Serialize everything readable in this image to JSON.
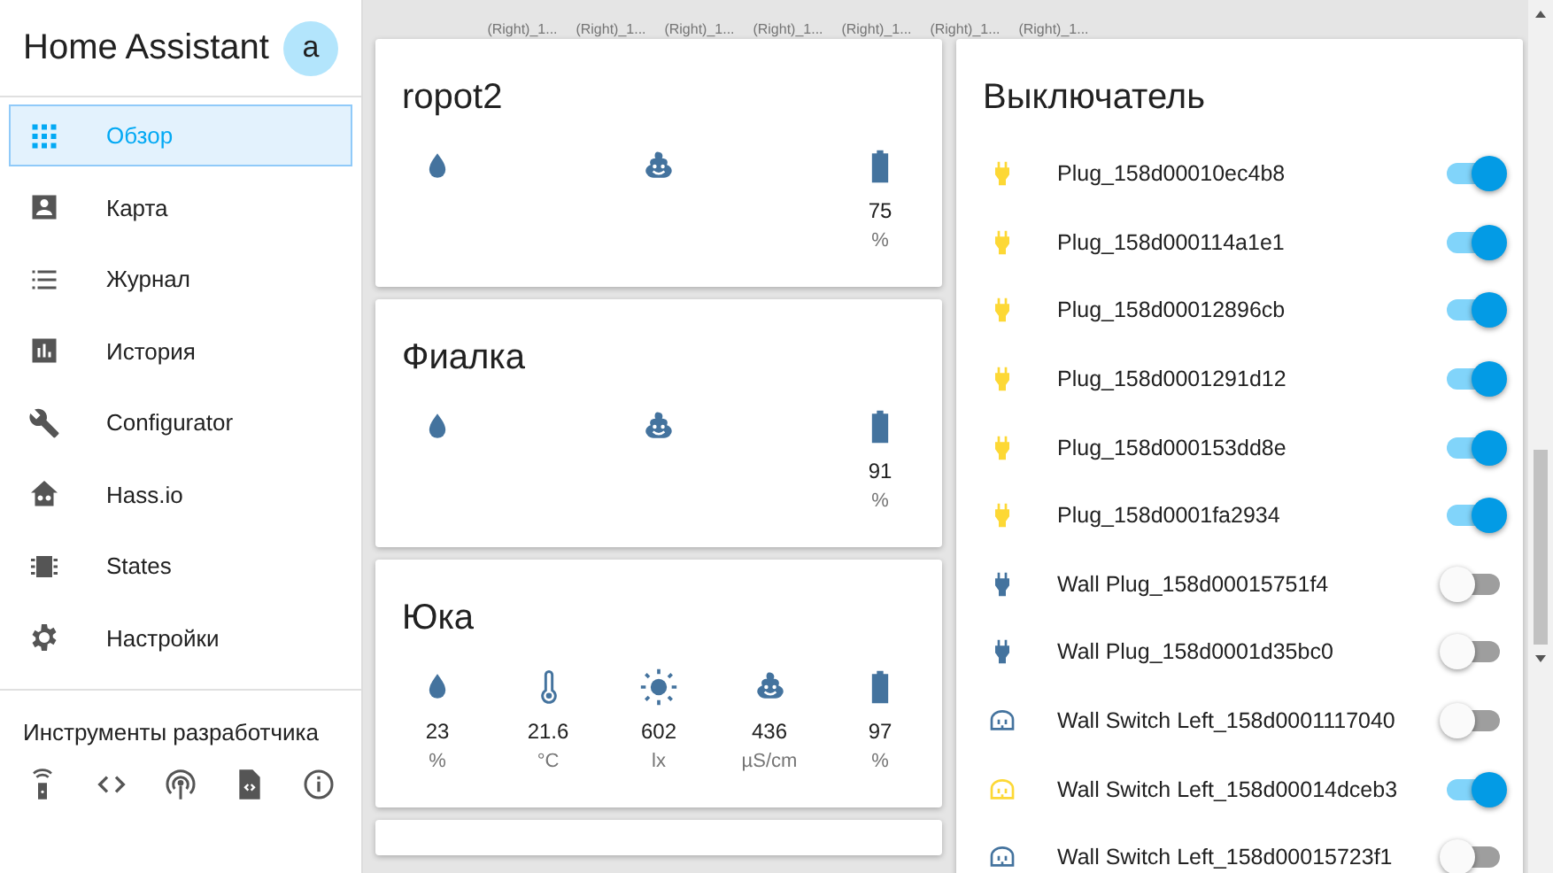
{
  "sidebar": {
    "title": "Home Assistant",
    "avatar": "a",
    "items": [
      {
        "label": "Обзор",
        "selected": true
      },
      {
        "label": "Карта",
        "selected": false
      },
      {
        "label": "Журнал",
        "selected": false
      },
      {
        "label": "История",
        "selected": false
      },
      {
        "label": "Configurator",
        "selected": false
      },
      {
        "label": "Hass.io",
        "selected": false
      },
      {
        "label": "States",
        "selected": false
      },
      {
        "label": "Настройки",
        "selected": false
      }
    ],
    "dev_tools_title": "Инструменты разработчика"
  },
  "badges": [
    "(Right)_1...",
    "(Right)_1...",
    "(Right)_1...",
    "(Right)_1...",
    "(Right)_1...",
    "(Right)_1...",
    "(Right)_1..."
  ],
  "plant_cards": [
    {
      "title": "ropot2",
      "sensors": [
        {
          "kind": "drop"
        },
        {
          "kind": "poop"
        },
        {
          "kind": "battery",
          "value": "75",
          "unit": "%"
        }
      ]
    },
    {
      "title": "Фиалка",
      "sensors": [
        {
          "kind": "drop"
        },
        {
          "kind": "poop"
        },
        {
          "kind": "battery",
          "value": "91",
          "unit": "%"
        }
      ]
    },
    {
      "title": "Юка",
      "sensors": [
        {
          "kind": "drop",
          "value": "23",
          "unit": "%"
        },
        {
          "kind": "thermometer",
          "value": "21.6",
          "unit": "°C"
        },
        {
          "kind": "sun",
          "value": "602",
          "unit": "lx"
        },
        {
          "kind": "poop",
          "value": "436",
          "unit": "µS/cm"
        },
        {
          "kind": "battery",
          "value": "97",
          "unit": "%"
        }
      ]
    }
  ],
  "switch_card": {
    "title": "Выключатель",
    "rows": [
      {
        "name": "Plug_158d00010ec4b8",
        "kind": "plug",
        "on": true
      },
      {
        "name": "Plug_158d000114a1e1",
        "kind": "plug",
        "on": true
      },
      {
        "name": "Plug_158d00012896cb",
        "kind": "plug",
        "on": true
      },
      {
        "name": "Plug_158d0001291d12",
        "kind": "plug",
        "on": true
      },
      {
        "name": "Plug_158d000153dd8e",
        "kind": "plug",
        "on": true
      },
      {
        "name": "Plug_158d0001fa2934",
        "kind": "plug",
        "on": true
      },
      {
        "name": "Wall Plug_158d00015751f4",
        "kind": "plug",
        "on": false
      },
      {
        "name": "Wall Plug_158d0001d35bc0",
        "kind": "plug",
        "on": false
      },
      {
        "name": "Wall Switch Left_158d0001117040",
        "kind": "outlet",
        "on": false
      },
      {
        "name": "Wall Switch Left_158d00014dceb3",
        "kind": "outlet",
        "on": true
      },
      {
        "name": "Wall Switch Left_158d00015723f1",
        "kind": "outlet",
        "on": false
      }
    ]
  }
}
